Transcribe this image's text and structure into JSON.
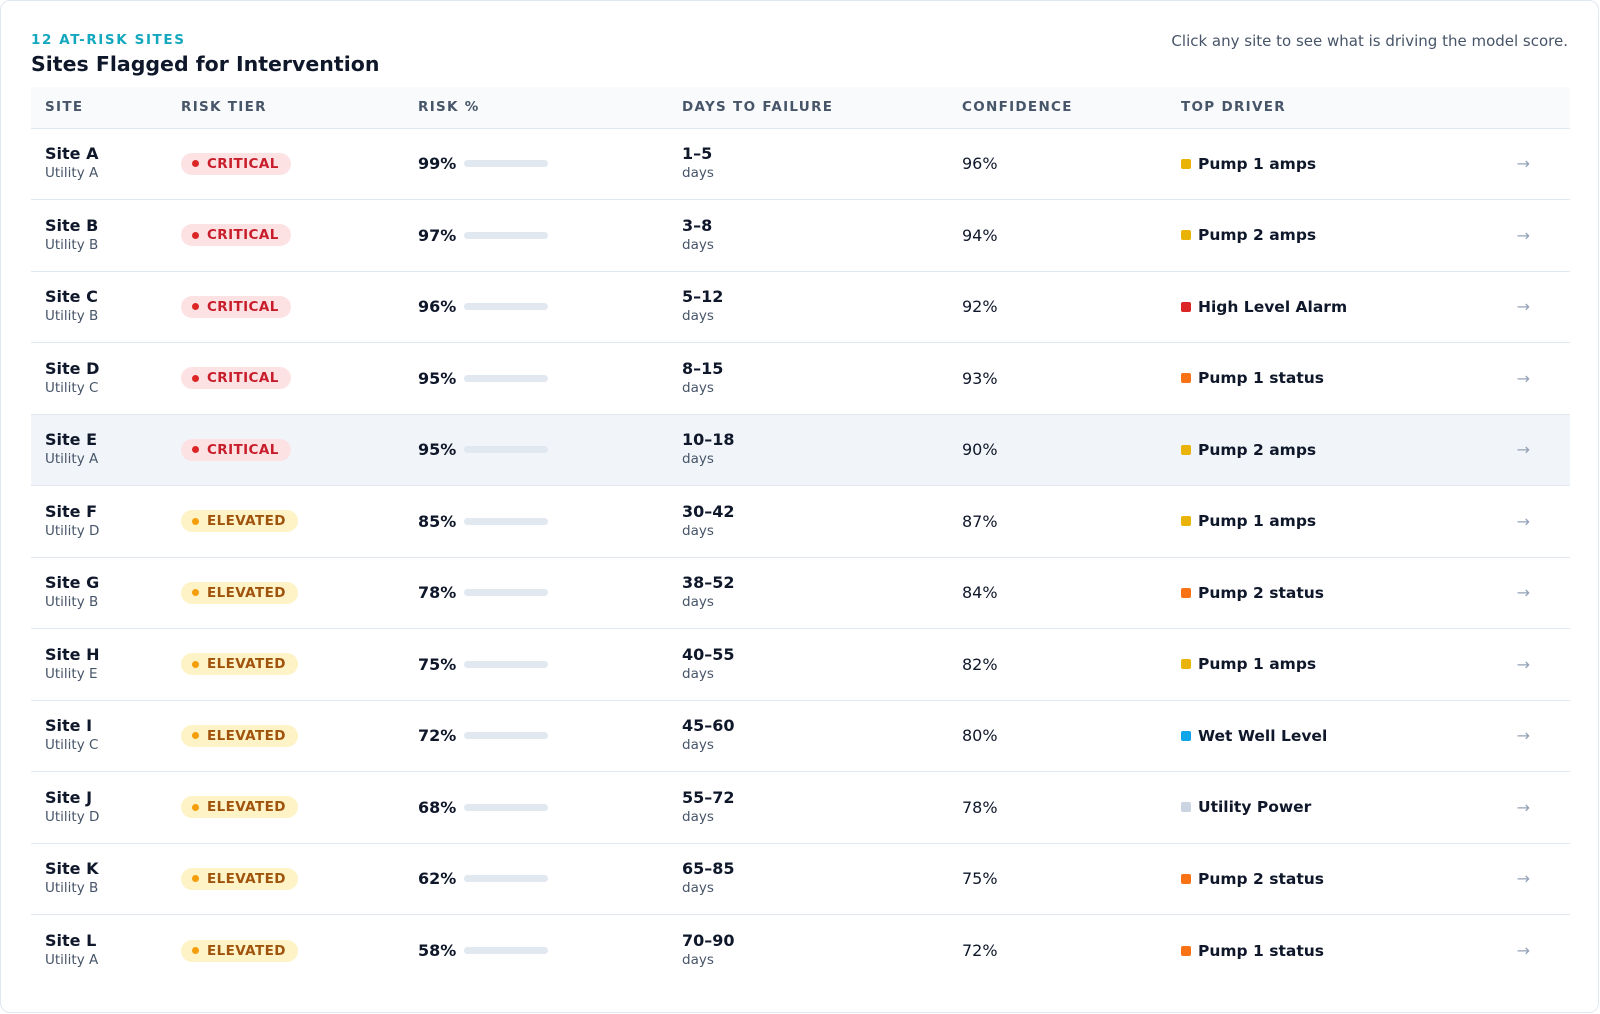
{
  "header": {
    "eyebrow": "12 AT-RISK SITES",
    "title": "Sites Flagged for Intervention",
    "hint": "Click any site to see what is driving the model score."
  },
  "columns": {
    "site": "SITE",
    "risk_tier": "RISK TIER",
    "risk_pct": "RISK %",
    "days_to_failure": "DAYS TO FAILURE",
    "confidence": "CONFIDENCE",
    "top_driver": "TOP DRIVER"
  },
  "tier_colors": {
    "critical": "#dc2626",
    "elevated": "#f59e0b"
  },
  "driver_colors": {
    "Pump 1 amps": "#eab308",
    "Pump 2 amps": "#eab308",
    "High Level Alarm": "#dc2626",
    "Pump 1 status": "#f97316",
    "Pump 2 status": "#f97316",
    "Wet Well Level": "#0ea5e9",
    "Utility Power": "#cbd5e1"
  },
  "rows": [
    {
      "site": "Site A",
      "utility": "Utility A",
      "tier": "CRITICAL",
      "tier_key": "critical",
      "risk": "99%",
      "days": "1–5",
      "days_unit": "days",
      "confidence": "96%",
      "driver": "Pump 1 amps",
      "arrow": "→"
    },
    {
      "site": "Site B",
      "utility": "Utility B",
      "tier": "CRITICAL",
      "tier_key": "critical",
      "risk": "97%",
      "days": "3–8",
      "days_unit": "days",
      "confidence": "94%",
      "driver": "Pump 2 amps",
      "arrow": "→"
    },
    {
      "site": "Site C",
      "utility": "Utility B",
      "tier": "CRITICAL",
      "tier_key": "critical",
      "risk": "96%",
      "days": "5–12",
      "days_unit": "days",
      "confidence": "92%",
      "driver": "High Level Alarm",
      "arrow": "→"
    },
    {
      "site": "Site D",
      "utility": "Utility C",
      "tier": "CRITICAL",
      "tier_key": "critical",
      "risk": "95%",
      "days": "8–15",
      "days_unit": "days",
      "confidence": "93%",
      "driver": "Pump 1 status",
      "arrow": "→"
    },
    {
      "site": "Site E",
      "utility": "Utility A",
      "tier": "CRITICAL",
      "tier_key": "critical",
      "risk": "95%",
      "days": "10–18",
      "days_unit": "days",
      "confidence": "90%",
      "driver": "Pump 2 amps",
      "arrow": "→",
      "hovered": true
    },
    {
      "site": "Site F",
      "utility": "Utility D",
      "tier": "ELEVATED",
      "tier_key": "elevated",
      "risk": "85%",
      "days": "30–42",
      "days_unit": "days",
      "confidence": "87%",
      "driver": "Pump 1 amps",
      "arrow": "→"
    },
    {
      "site": "Site G",
      "utility": "Utility B",
      "tier": "ELEVATED",
      "tier_key": "elevated",
      "risk": "78%",
      "days": "38–52",
      "days_unit": "days",
      "confidence": "84%",
      "driver": "Pump 2 status",
      "arrow": "→"
    },
    {
      "site": "Site H",
      "utility": "Utility E",
      "tier": "ELEVATED",
      "tier_key": "elevated",
      "risk": "75%",
      "days": "40–55",
      "days_unit": "days",
      "confidence": "82%",
      "driver": "Pump 1 amps",
      "arrow": "→"
    },
    {
      "site": "Site I",
      "utility": "Utility C",
      "tier": "ELEVATED",
      "tier_key": "elevated",
      "risk": "72%",
      "days": "45–60",
      "days_unit": "days",
      "confidence": "80%",
      "driver": "Wet Well Level",
      "arrow": "→"
    },
    {
      "site": "Site J",
      "utility": "Utility D",
      "tier": "ELEVATED",
      "tier_key": "elevated",
      "risk": "68%",
      "days": "55–72",
      "days_unit": "days",
      "confidence": "78%",
      "driver": "Utility Power",
      "arrow": "→"
    },
    {
      "site": "Site K",
      "utility": "Utility B",
      "tier": "ELEVATED",
      "tier_key": "elevated",
      "risk": "62%",
      "days": "65–85",
      "days_unit": "days",
      "confidence": "75%",
      "driver": "Pump 2 status",
      "arrow": "→"
    },
    {
      "site": "Site L",
      "utility": "Utility A",
      "tier": "ELEVATED",
      "tier_key": "elevated",
      "risk": "58%",
      "days": "70–90",
      "days_unit": "days",
      "confidence": "72%",
      "driver": "Pump 1 status",
      "arrow": "→"
    }
  ]
}
